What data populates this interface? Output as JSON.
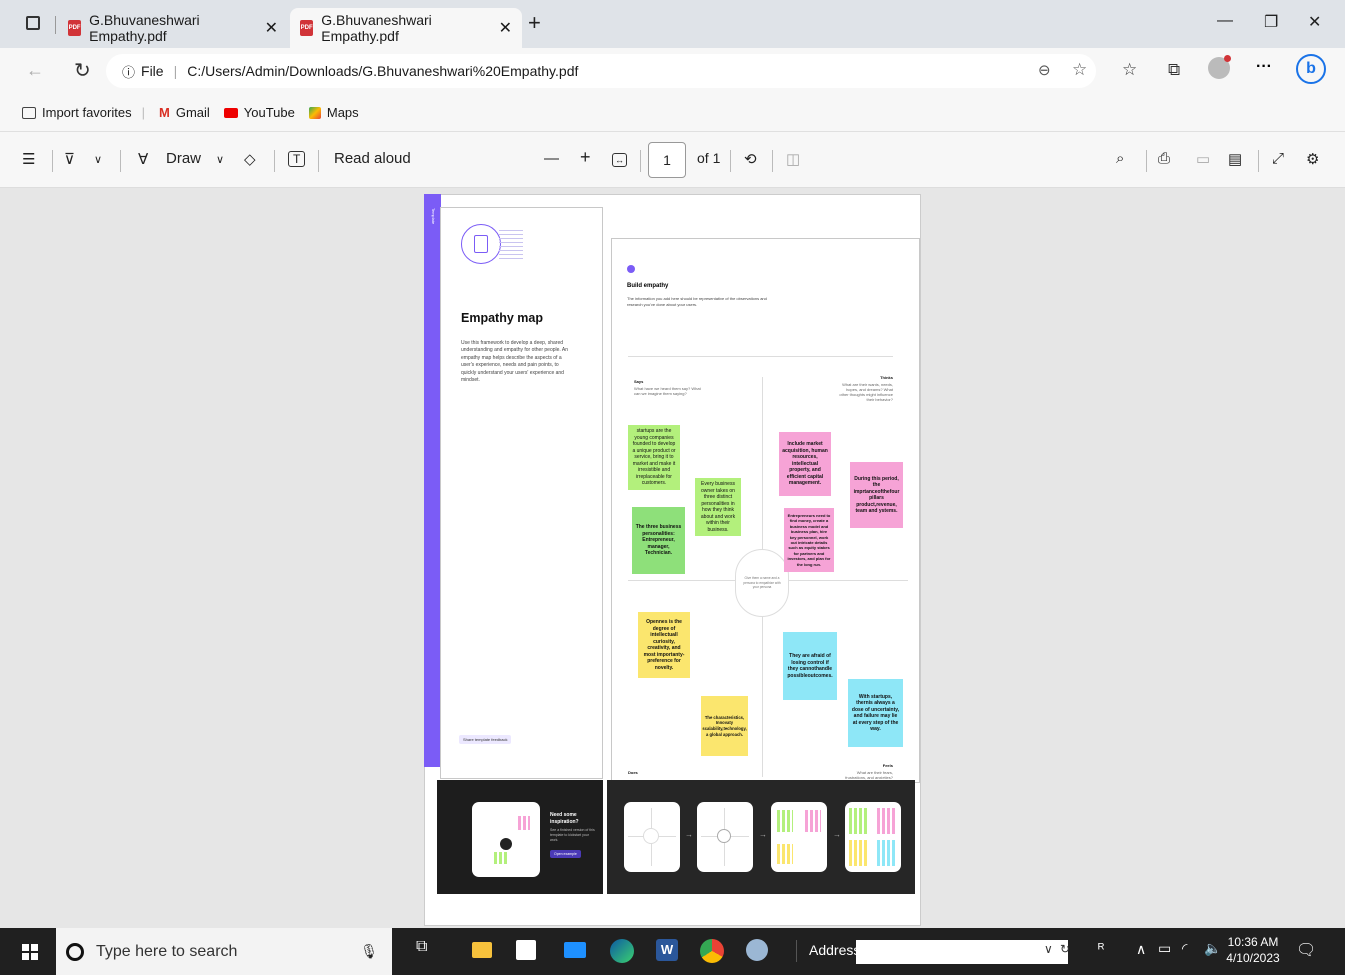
{
  "tabs": [
    {
      "title": "G.Bhuvaneshwari Empathy.pdf"
    },
    {
      "title": "G.Bhuvaneshwari Empathy.pdf"
    }
  ],
  "address": {
    "scheme_label": "File",
    "url": "C:/Users/Admin/Downloads/G.Bhuvaneshwari%20Empathy.pdf"
  },
  "favorites": [
    "Import favorites",
    "Gmail",
    "YouTube",
    "Maps"
  ],
  "pdf_toolbar": {
    "draw": "Draw",
    "read_aloud": "Read aloud",
    "page": "1",
    "of": "of 1"
  },
  "doc": {
    "side_label": "Template",
    "title": "Empathy map",
    "description": "Use this framework to develop a deep, shared understanding and empathy for other people. An empathy map helps describe the aspects of a user's experience, needs and pain points, to quickly understand your users' experience and mindset.",
    "feedback": "Share template feedback",
    "build_title": "Build empathy",
    "build_desc": "The information you add here should be representative of the observations and research you've done about your users.",
    "says": "Says",
    "says_sub": "What have we heard them say? What can we imagine them saying?",
    "thinks": "Thinks",
    "thinks_sub": "What are their wants, needs, hopes, and dreams? What other thoughts might influence their behavior?",
    "does": "Does",
    "feels": "Feels",
    "feels_sub": "What are their fears, frustrations, and anxieties?",
    "center": "Give them a name and a persona to empathize with your persona",
    "notes": {
      "n1": "startups are the young companies founded to develop a unique product or service, bring it to market and make it irresistible and irreplaceable for customers.",
      "n2": "Every business owner takes on three distinct personalities in how they think about and work within their business.",
      "n3": "The three business personalities: Entrepreneur, manager, Technician.",
      "n4": "Include market acquisition, human resources, intellectual property, and efficient capital management.",
      "n5": "Entrepreneurs need to find money, create a business model and business plan, hire key personnel, work out intricate details such as equity stakes for partners and investors, and plan for the long run.",
      "n6": "During this period, the imprtanceofthefour pillars product,revenue, team and ystems.",
      "n7": "Opennes is the degree of intellectuall curiosity, creativity, and most importanty- preference for novelty.",
      "n8": "The characteristics, Innovaty scalability,technology, a global approach.",
      "n9": "They are afraid of losing control if they cannothandle possibleoutcomes.",
      "n10": "With startups, thernis always a dose of uncertainty, and failure may lie at every step of the way."
    },
    "inspire_title": "Need some inspiration?",
    "inspire_desc": "See a finished version of this template to kickstart your work.",
    "inspire_btn": "Open example"
  },
  "taskbar": {
    "search": "Type here to search",
    "address": "Address",
    "time": "10:36 AM",
    "date": "4/10/2023"
  }
}
